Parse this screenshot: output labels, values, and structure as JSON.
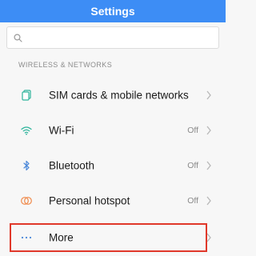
{
  "header": {
    "title": "Settings"
  },
  "search": {
    "placeholder": "",
    "icon": "search-icon"
  },
  "section": {
    "label": "WIRELESS & NETWORKS"
  },
  "items": [
    {
      "label": "SIM cards & mobile networks",
      "value": "",
      "icon": "sim-card-icon"
    },
    {
      "label": "Wi-Fi",
      "value": "Off",
      "icon": "wifi-icon"
    },
    {
      "label": "Bluetooth",
      "value": "Off",
      "icon": "bluetooth-icon"
    },
    {
      "label": "Personal hotspot",
      "value": "Off",
      "icon": "hotspot-icon"
    },
    {
      "label": "More",
      "value": "",
      "icon": "more-icon"
    }
  ],
  "colors": {
    "accent": "#3d8df5",
    "icon_blue": "#4a87d9",
    "icon_green": "#2bb39a",
    "icon_orange": "#f08a4b",
    "highlight_red": "#e0382a"
  }
}
